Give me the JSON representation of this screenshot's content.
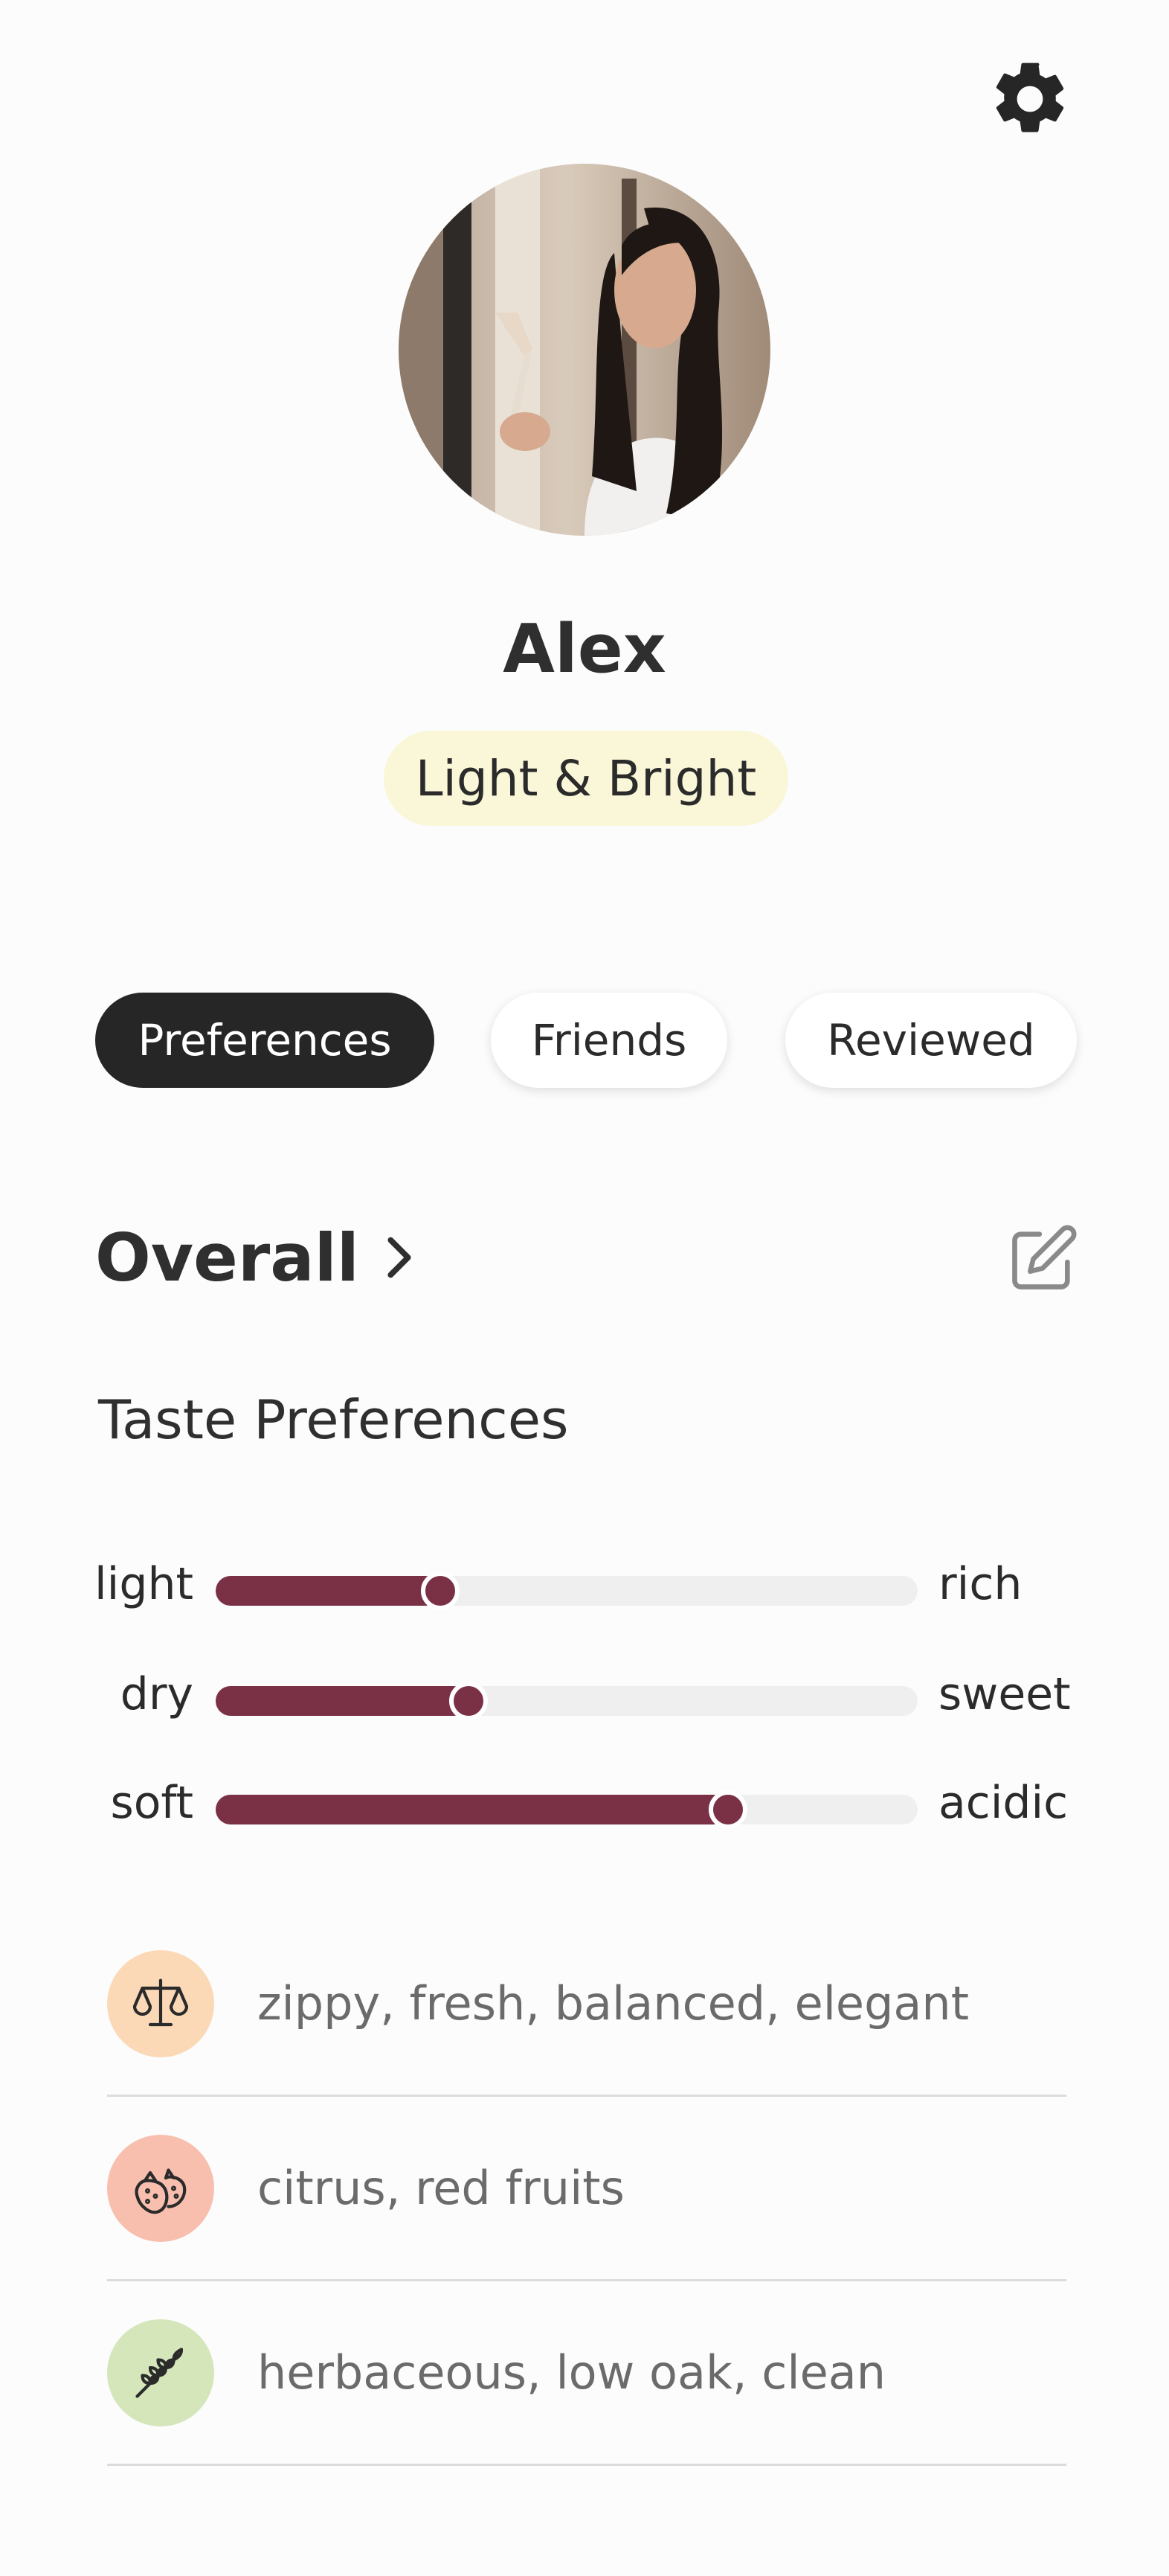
{
  "profile": {
    "name": "Alex",
    "badge": "Light & Bright"
  },
  "tabs": [
    {
      "label": "Preferences",
      "active": true
    },
    {
      "label": "Friends",
      "active": false
    },
    {
      "label": "Reviewed",
      "active": false
    }
  ],
  "overall": {
    "title": "Overall"
  },
  "taste": {
    "title": "Taste Preferences",
    "sliders": [
      {
        "left": "light",
        "right": "rich",
        "value": 0.32
      },
      {
        "left": "dry",
        "right": "sweet",
        "value": 0.36
      },
      {
        "left": "soft",
        "right": "acidic",
        "value": 0.73
      }
    ]
  },
  "notes": [
    {
      "icon": "scales-icon",
      "text": "zippy, fresh, balanced, elegant",
      "color": "#fbd9b6"
    },
    {
      "icon": "strawberry-icon",
      "text": "citrus, red fruits",
      "color": "#f8bfae"
    },
    {
      "icon": "wheat-icon",
      "text": "herbaceous, low oak, clean",
      "color": "#d5e6bb"
    }
  ],
  "colors": {
    "accent": "#7a3146",
    "badge_bg": "#faf6d8",
    "active_tab": "#262626"
  }
}
